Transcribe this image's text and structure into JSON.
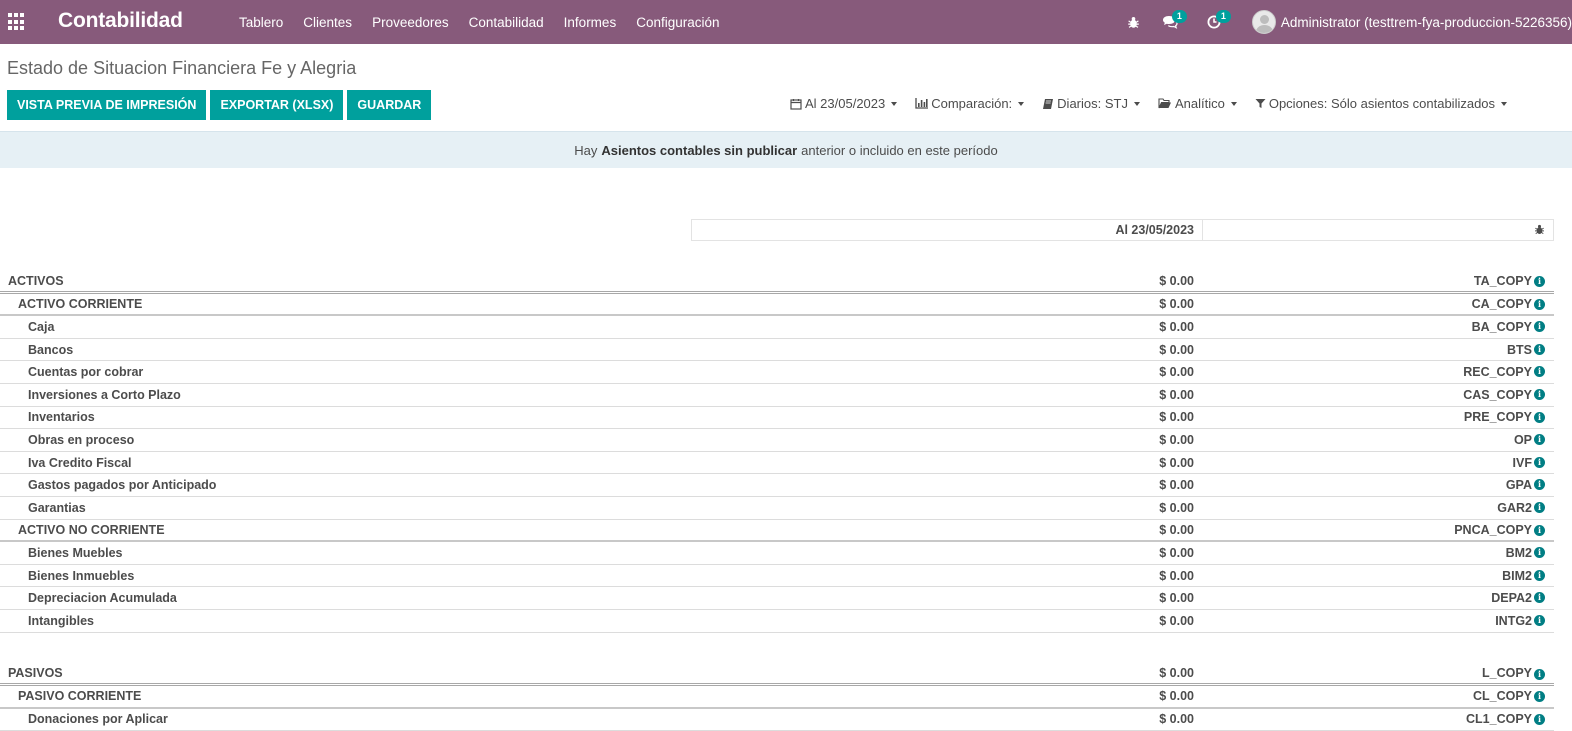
{
  "navbar": {
    "brand": "Contabilidad",
    "menu": [
      "Tablero",
      "Clientes",
      "Proveedores",
      "Contabilidad",
      "Informes",
      "Configuración"
    ],
    "messages_count": "1",
    "activities_count": "1",
    "user": "Administrator (testtrem-fya-produccion-5226356)"
  },
  "page": {
    "title": "Estado de Situacion Financiera Fe y Alegria",
    "buttons": {
      "print_preview": "VISTA PREVIA DE IMPRESIÓN",
      "export": "EXPORTAR (XLSX)",
      "save": "GUARDAR"
    },
    "filters": {
      "date": "Al 23/05/2023",
      "comparison": "Comparación:",
      "journals": "Diarios: STJ",
      "analytic": "Analítico",
      "options": "Opciones: Sólo asientos contabilizados"
    },
    "alert": {
      "prefix": "Hay",
      "bold": "Asientos contables sin publicar",
      "suffix": "anterior o incluido en este período"
    }
  },
  "report": {
    "column_header": "Al 23/05/2023",
    "rows_assets": [
      {
        "name": "ACTIVOS",
        "amount": "$ 0.00",
        "code": "TA_COPY",
        "level": 0
      },
      {
        "name": "ACTIVO CORRIENTE",
        "amount": "$ 0.00",
        "code": "CA_COPY",
        "level": 1
      },
      {
        "name": "Caja",
        "amount": "$ 0.00",
        "code": "BA_COPY",
        "level": 2
      },
      {
        "name": "Bancos",
        "amount": "$ 0.00",
        "code": "BTS",
        "level": 2
      },
      {
        "name": "Cuentas por cobrar",
        "amount": "$ 0.00",
        "code": "REC_COPY",
        "level": 2
      },
      {
        "name": "Inversiones a Corto Plazo",
        "amount": "$ 0.00",
        "code": "CAS_COPY",
        "level": 2
      },
      {
        "name": "Inventarios",
        "amount": "$ 0.00",
        "code": "PRE_COPY",
        "level": 2
      },
      {
        "name": "Obras en proceso",
        "amount": "$ 0.00",
        "code": "OP",
        "level": 2
      },
      {
        "name": "Iva Credito Fiscal",
        "amount": "$ 0.00",
        "code": "IVF",
        "level": 2
      },
      {
        "name": "Gastos pagados por Anticipado",
        "amount": "$ 0.00",
        "code": "GPA",
        "level": 2
      },
      {
        "name": "Garantias",
        "amount": "$ 0.00",
        "code": "GAR2",
        "level": 2
      },
      {
        "name": "ACTIVO NO CORRIENTE",
        "amount": "$ 0.00",
        "code": "PNCA_COPY",
        "level": 1
      },
      {
        "name": "Bienes Muebles",
        "amount": "$ 0.00",
        "code": "BM2",
        "level": 2
      },
      {
        "name": "Bienes Inmuebles",
        "amount": "$ 0.00",
        "code": "BIM2",
        "level": 2
      },
      {
        "name": "Depreciacion Acumulada",
        "amount": "$ 0.00",
        "code": "DEPA2",
        "level": 2
      },
      {
        "name": "Intangibles",
        "amount": "$ 0.00",
        "code": "INTG2",
        "level": 2
      }
    ],
    "rows_liabilities": [
      {
        "name": "PASIVOS",
        "amount": "$ 0.00",
        "code": "L_COPY",
        "level": 0
      },
      {
        "name": "PASIVO CORRIENTE",
        "amount": "$ 0.00",
        "code": "CL_COPY",
        "level": 1
      },
      {
        "name": "Donaciones por Aplicar",
        "amount": "$ 0.00",
        "code": "CL1_COPY",
        "level": 2
      }
    ],
    "info_glyph": "i"
  },
  "colors": {
    "navbar": "#875a7b",
    "primary": "#00a09d",
    "info": "#017e84",
    "alert_bg": "#e6f0f5"
  }
}
